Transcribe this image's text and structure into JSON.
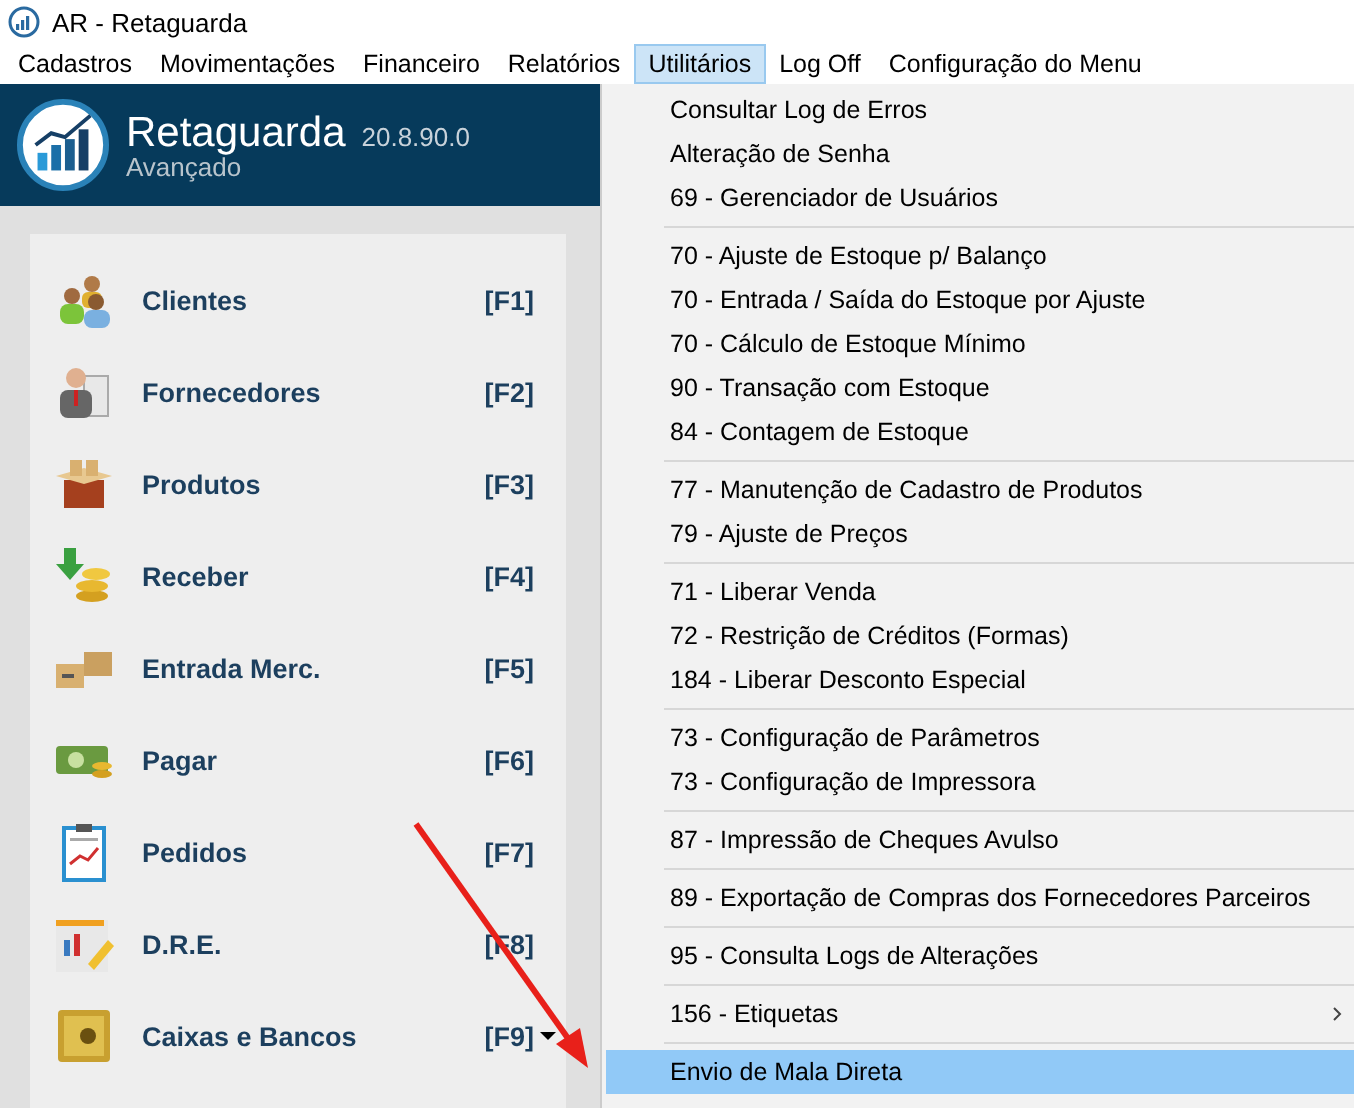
{
  "window": {
    "title": "AR - Retaguarda"
  },
  "menubar": [
    {
      "label": "Cadastros",
      "selected": false
    },
    {
      "label": "Movimentações",
      "selected": false
    },
    {
      "label": "Financeiro",
      "selected": false
    },
    {
      "label": "Relatórios",
      "selected": false
    },
    {
      "label": "Utilitários",
      "selected": true
    },
    {
      "label": "Log Off",
      "selected": false
    },
    {
      "label": "Configuração do Menu",
      "selected": false
    }
  ],
  "header": {
    "title": "Retaguarda",
    "version": "20.8.90.0",
    "subtitle": "Avançado"
  },
  "sidebar": {
    "items": [
      {
        "label": "Clientes",
        "key": "[F1]",
        "dropdown": false
      },
      {
        "label": "Fornecedores",
        "key": "[F2]",
        "dropdown": false
      },
      {
        "label": "Produtos",
        "key": "[F3]",
        "dropdown": false
      },
      {
        "label": "Receber",
        "key": "[F4]",
        "dropdown": false
      },
      {
        "label": "Entrada Merc.",
        "key": "[F5]",
        "dropdown": false
      },
      {
        "label": "Pagar",
        "key": "[F6]",
        "dropdown": false
      },
      {
        "label": "Pedidos",
        "key": "[F7]",
        "dropdown": false
      },
      {
        "label": "D.R.E.",
        "key": "[F8]",
        "dropdown": false
      },
      {
        "label": "Caixas e Bancos",
        "key": "[F9]",
        "dropdown": true
      }
    ]
  },
  "dropdown_menu": {
    "groups": [
      [
        {
          "label": "Consultar Log de Erros",
          "selected": false,
          "submenu": false
        },
        {
          "label": "Alteração de Senha",
          "selected": false,
          "submenu": false
        },
        {
          "label": "69 - Gerenciador de Usuários",
          "selected": false,
          "submenu": false
        }
      ],
      [
        {
          "label": "70 - Ajuste de Estoque p/ Balanço",
          "selected": false,
          "submenu": false
        },
        {
          "label": "70 - Entrada / Saída do Estoque por Ajuste",
          "selected": false,
          "submenu": false
        },
        {
          "label": "70 - Cálculo de Estoque Mínimo",
          "selected": false,
          "submenu": false
        },
        {
          "label": "90 - Transação com Estoque",
          "selected": false,
          "submenu": false
        },
        {
          "label": "84 - Contagem de Estoque",
          "selected": false,
          "submenu": false
        }
      ],
      [
        {
          "label": "77 - Manutenção de Cadastro de Produtos",
          "selected": false,
          "submenu": false
        },
        {
          "label": "79 - Ajuste de Preços",
          "selected": false,
          "submenu": false
        }
      ],
      [
        {
          "label": "71 - Liberar Venda",
          "selected": false,
          "submenu": false
        },
        {
          "label": "72 - Restrição de Créditos (Formas)",
          "selected": false,
          "submenu": false
        },
        {
          "label": "184 - Liberar Desconto Especial",
          "selected": false,
          "submenu": false
        }
      ],
      [
        {
          "label": "73 - Configuração de Parâmetros",
          "selected": false,
          "submenu": false
        },
        {
          "label": "73 - Configuração de Impressora",
          "selected": false,
          "submenu": false
        }
      ],
      [
        {
          "label": "87 - Impressão de Cheques Avulso",
          "selected": false,
          "submenu": false
        }
      ],
      [
        {
          "label": "89 - Exportação de Compras dos Fornecedores Parceiros",
          "selected": false,
          "submenu": false
        }
      ],
      [
        {
          "label": "95 - Consulta Logs de Alterações",
          "selected": false,
          "submenu": false
        }
      ],
      [
        {
          "label": "156 - Etiquetas",
          "selected": false,
          "submenu": true
        }
      ],
      [
        {
          "label": "Envio de Mala Direta",
          "selected": true,
          "submenu": false
        }
      ]
    ]
  }
}
